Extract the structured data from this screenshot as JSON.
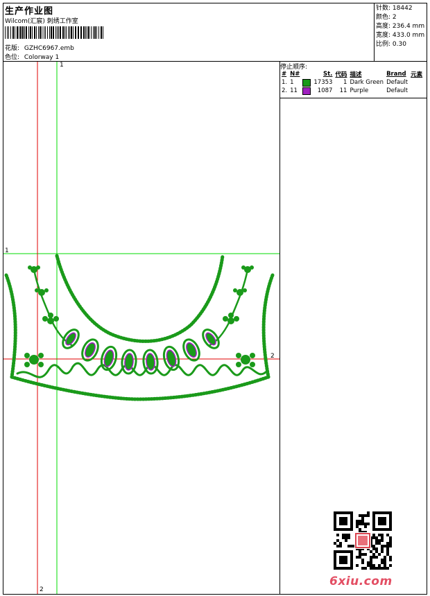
{
  "header": {
    "title": "生产作业图",
    "company": "Wilcom(汇宸) 刺绣工作室",
    "design_label": "花版:",
    "design_value": "GZHC6967.emb",
    "colorway_label": "色位:",
    "colorway_value": "Colorway 1"
  },
  "stats": {
    "stitches_label": "针数:",
    "stitches": "18442",
    "colors_label": "颜色:",
    "colors": "2",
    "height_label": "高度:",
    "height": "236.4 mm",
    "width_label": "宽度:",
    "width": "433.0 mm",
    "scale_label": "比例:",
    "scale": "0.30"
  },
  "stop_sequence": {
    "title": "停止顺序:",
    "headers": [
      "#",
      "N#",
      "St.",
      "代码",
      "描述",
      "Brand",
      "元素"
    ],
    "rows": [
      {
        "num": "1.",
        "n": "1",
        "color": "#1a9a1a",
        "st": "17353",
        "code": "1",
        "desc": "Dark Green",
        "brand": "Default"
      },
      {
        "num": "2.",
        "n": "11",
        "color": "#a020c0",
        "st": "1087",
        "code": "11",
        "desc": "Purple",
        "brand": "Default"
      }
    ]
  },
  "axes": {
    "green_v_top": "1",
    "green_h_left": "1",
    "red_h_right": "2",
    "red_v_bottom": "2"
  },
  "watermark": "6xiu.com",
  "colors": {
    "green_axis": "#00dd00",
    "red_axis": "#e00000",
    "stitch_green": "#1a9a1a",
    "purple": "#a020c0"
  }
}
